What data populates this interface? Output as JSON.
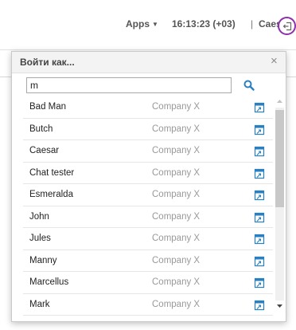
{
  "header": {
    "apps_label": "Apps",
    "time": "16:13:23 (+03)",
    "separator": "|",
    "username": "Caesar",
    "logout_icon": "logout-icon",
    "highlight_color": "#8e2fae"
  },
  "dialog": {
    "title": "Войти как...",
    "close_glyph": "×",
    "search_value": "m",
    "search_icon": "search-icon",
    "accent_color": "#2a7fc1",
    "users": [
      {
        "name": "Bad Man",
        "company": "Company X"
      },
      {
        "name": "Butch",
        "company": "Company X"
      },
      {
        "name": "Caesar",
        "company": "Company X"
      },
      {
        "name": "Chat tester",
        "company": "Company X"
      },
      {
        "name": "Esmeralda",
        "company": "Company X"
      },
      {
        "name": "John",
        "company": "Company X"
      },
      {
        "name": "Jules",
        "company": "Company X"
      },
      {
        "name": "Manny",
        "company": "Company X"
      },
      {
        "name": "Marcellus",
        "company": "Company X"
      },
      {
        "name": "Mark",
        "company": "Company X"
      }
    ]
  }
}
